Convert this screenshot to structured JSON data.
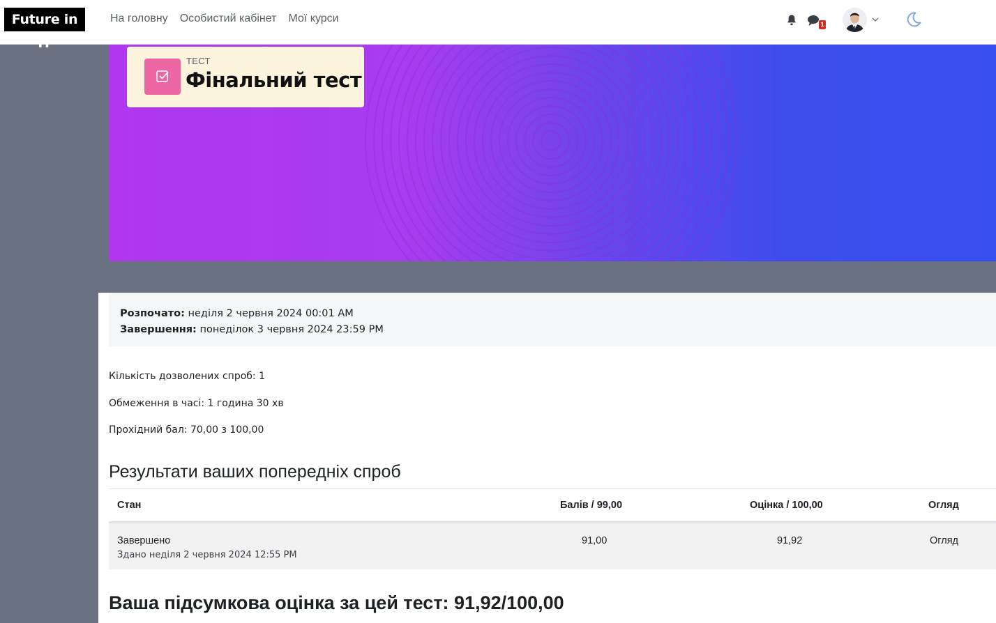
{
  "brand": {
    "name": "Future in IT"
  },
  "nav": {
    "links": [
      "На головну",
      "Особистий кабінет",
      "Мої курси"
    ],
    "messages_badge": "1"
  },
  "header": {
    "activity_type": "ТЕСТ",
    "title": "Фінальний тест"
  },
  "dates": {
    "opened_label": "Розпочато:",
    "opened_value": "неділя 2 червня 2024 00:01 AM",
    "closed_label": "Завершення:",
    "closed_value": "понеділок 3 червня 2024 23:59 PM"
  },
  "quiz_info": {
    "attempts_allowed": "Кількість дозволених спроб: 1",
    "time_limit": "Обмеження в часі: 1 година 30 хв",
    "passing_grade": "Прохідний бал: 70,00 з 100,00"
  },
  "attempts": {
    "title": "Результати ваших попередніх спроб",
    "columns": {
      "state": "Стан",
      "marks": "Балів / 99,00",
      "grade": "Оцінка / 100,00",
      "review": "Огляд"
    },
    "rows": [
      {
        "state": "Завершено",
        "submitted": "Здано неділя 2 червня 2024 12:55 PM",
        "marks": "91,00",
        "grade": "91,92",
        "review": "Огляд"
      }
    ]
  },
  "final_grade": "Ваша підсумкова оцінка за цей тест: 91,92/100,00",
  "colors": {
    "banner_start": "#b037ee",
    "banner_end": "#374eee",
    "activity_icon": "#eb66a2",
    "title_card": "#fcf4dc",
    "badge": "#ca3120"
  },
  "icons": [
    "bell-icon",
    "chat-icon",
    "chevron-down-icon",
    "moon-icon",
    "quiz-check-icon"
  ]
}
